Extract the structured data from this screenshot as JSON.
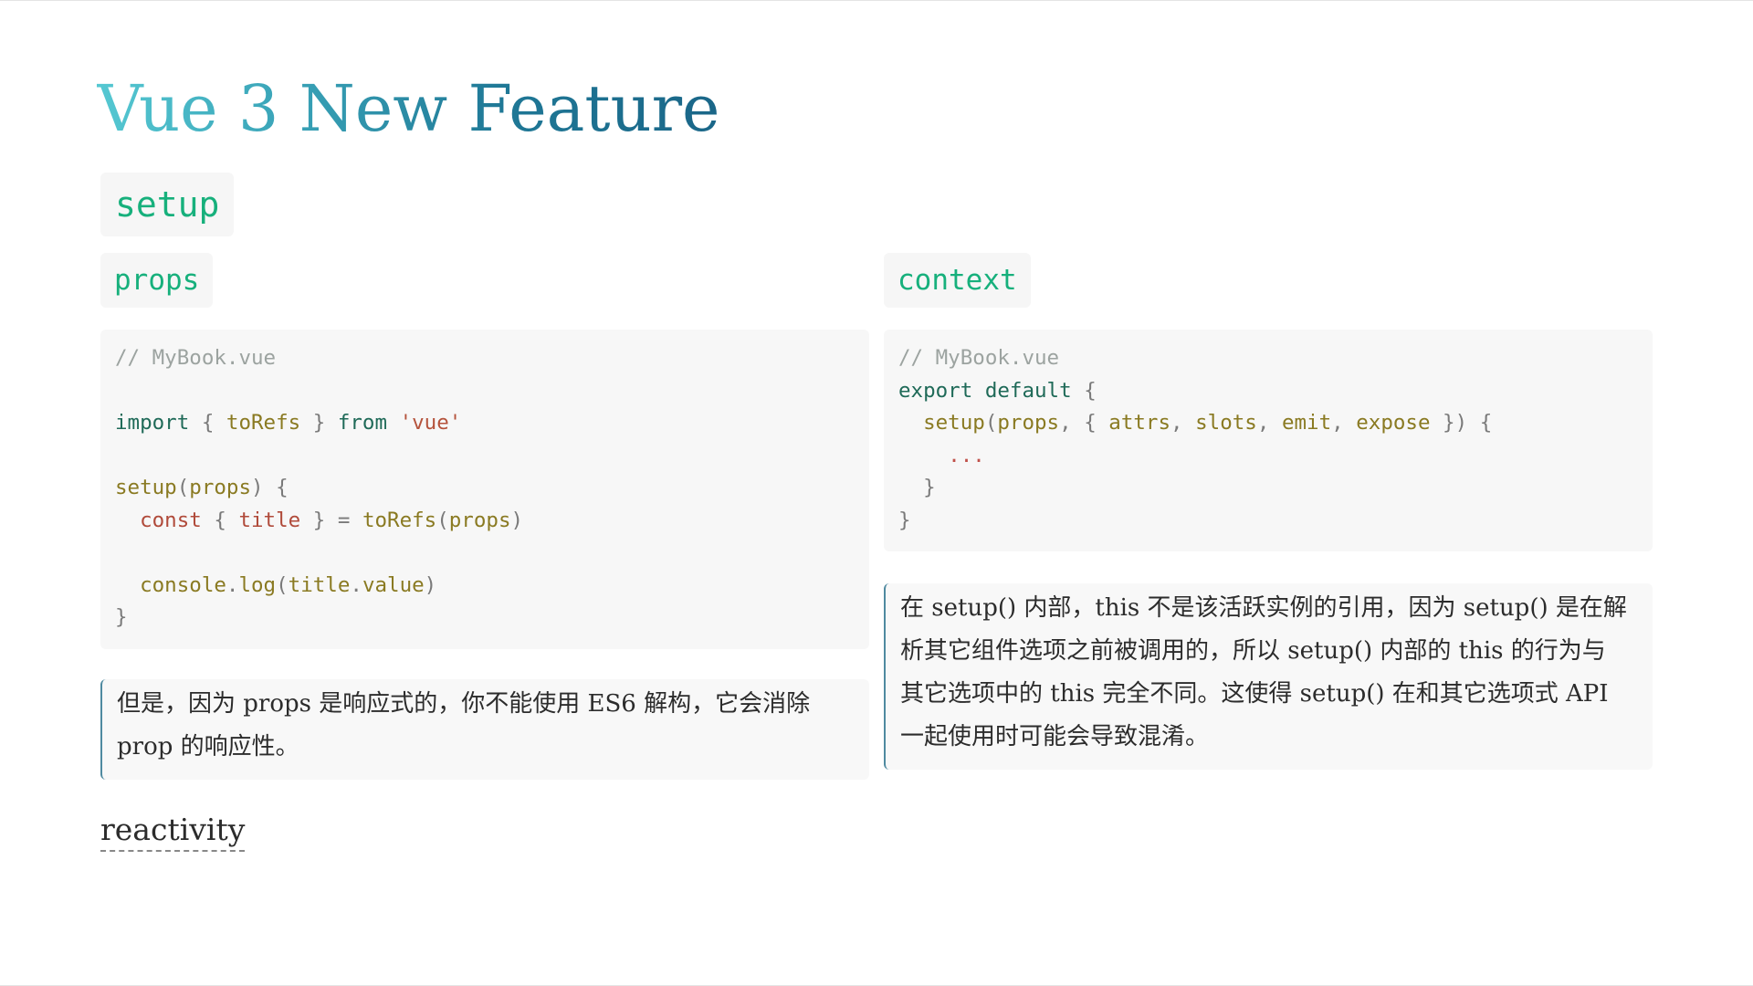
{
  "slide": {
    "title": "Vue 3 New Feature",
    "section_heading": "setup",
    "left_heading": "props",
    "right_heading": "context",
    "footer_link": "reactivity"
  },
  "code_left": {
    "comment": "// MyBook.vue",
    "import_kw": "import",
    "import_open": " { ",
    "import_name": "toRefs",
    "import_close": " } ",
    "from_kw": "from",
    "from_sp": " ",
    "module": "'vue'",
    "setup_fn": "setup",
    "setup_open": "(",
    "setup_param": "props",
    "setup_close": ") {",
    "const_indent": "  ",
    "const_kw": "const",
    "destructure_open": " { ",
    "title_var": "title",
    "destructure_close": " } = ",
    "torefs_call": "toRefs",
    "torefs_open": "(",
    "torefs_arg": "props",
    "torefs_close": ")",
    "log_indent": "  ",
    "console_obj": "console",
    "dot1": ".",
    "log_fn": "log",
    "log_open": "(",
    "log_arg_obj": "title",
    "dot2": ".",
    "log_arg_prop": "value",
    "log_close": ")",
    "close_brace": "}"
  },
  "code_right": {
    "comment": "// MyBook.vue",
    "export_kw": "export default",
    "export_brace": " {",
    "setup_indent": "  ",
    "setup_fn": "setup",
    "p_open": "(",
    "p_props": "props",
    "p_sep1": ", { ",
    "p_attrs": "attrs",
    "p_sep2": ", ",
    "p_slots": "slots",
    "p_sep3": ", ",
    "p_emit": "emit",
    "p_sep4": ", ",
    "p_expose": "expose",
    "p_close": " }) {",
    "dots_indent": "    ",
    "dots": "...",
    "inner_close": "  }",
    "outer_close": "}"
  },
  "notes": {
    "left_line1": "但是，因为 props 是响应式的，你不能使用 ES6 解构，它会消除",
    "left_line2": "prop 的响应性。",
    "right_line1": "在 setup() 内部，this 不是该活跃实例的引用，因为 setup() 是在解",
    "right_line2": "析其它组件选项之前被调用的，所以 setup() 内部的 this 的行为与",
    "right_line3": "其它选项中的 this 完全不同。这使得 setup() 在和其它选项式 API",
    "right_line4": "一起使用时可能会导致混淆。"
  }
}
